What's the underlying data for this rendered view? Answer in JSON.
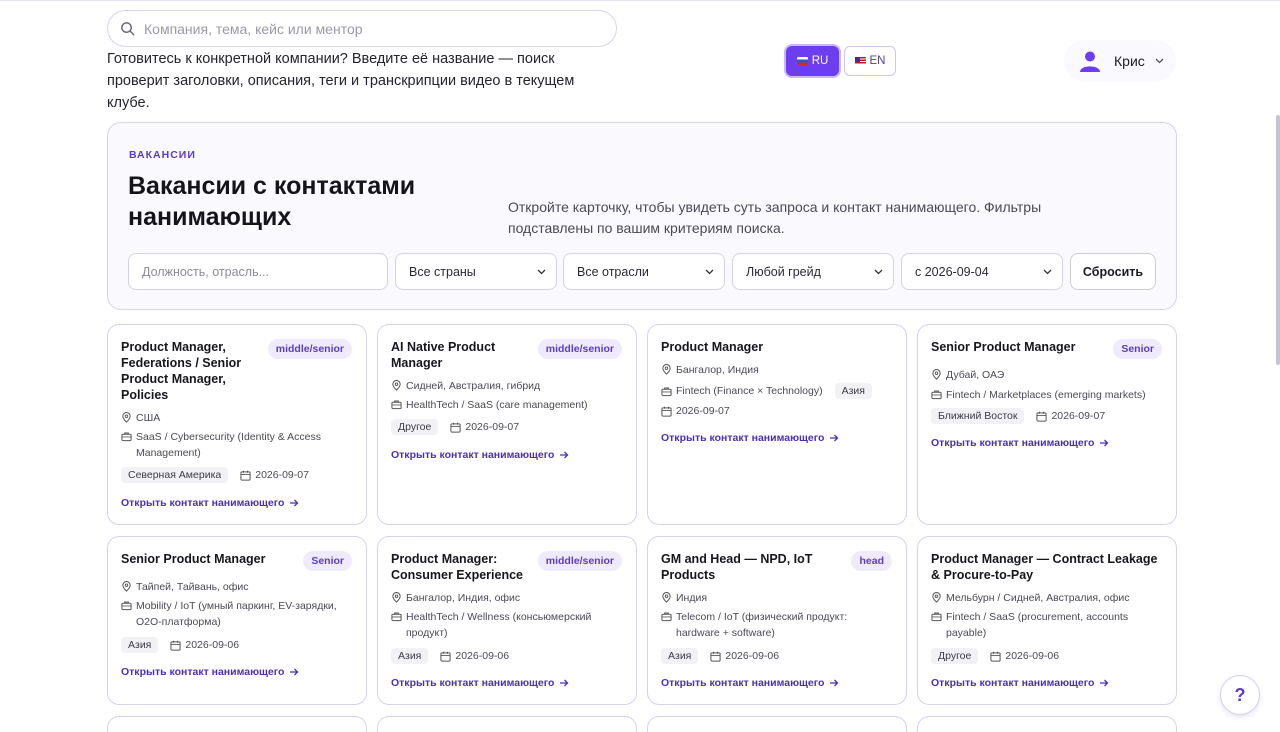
{
  "header": {
    "search_placeholder": "Компания, тема, кейс или ментор",
    "hint": "Готовитесь к конкретной компании? Введите её название — поиск проверит заголовки, описания, теги и транскрипции видео в текущем клубе.",
    "lang_ru": "RU",
    "lang_en": "EN",
    "user_name": "Крис"
  },
  "panel": {
    "eyebrow": "ВАКАНСИИ",
    "title": "Вакансии с контактами нанимающих",
    "description": "Откройте карточку, чтобы увидеть суть запроса и контакт нанимающего. Фильтры подставлены по вашим критериям поиска.",
    "filters": {
      "role_placeholder": "Должность, отрасль...",
      "country": "Все страны",
      "industry": "Все отрасли",
      "grade": "Любой грейд",
      "date": "с 2026-09-04",
      "reset": "Сбросить"
    }
  },
  "cta_label": "Открыть контакт нанимающего",
  "help_label": "?",
  "cards": [
    {
      "title": "Product Manager, Federations / Senior Product Manager, Policies",
      "badge": "middle/senior",
      "location": "США",
      "industry": "SaaS / Cybersecurity (Identity & Access Management)",
      "region": "Северная Америка",
      "date": "2026-09-07"
    },
    {
      "title": "AI Native Product Manager",
      "badge": "middle/senior",
      "location": "Сидней, Австралия, гибрид",
      "industry": "HealthTech / SaaS (care management)",
      "region": "Другое",
      "date": "2026-09-07"
    },
    {
      "title": "Product Manager",
      "badge": "",
      "location": "Бангалор, Индия",
      "industry": "Fintech (Finance × Technology)",
      "region": "Азия",
      "date": "2026-09-07"
    },
    {
      "title": "Senior Product Manager",
      "badge": "Senior",
      "location": "Дубай, ОАЭ",
      "industry": "Fintech / Marketplaces (emerging markets)",
      "region": "Ближний Восток",
      "date": "2026-09-07"
    },
    {
      "title": "Senior Product Manager",
      "badge": "Senior",
      "location": "Тайпей, Тайвань, офис",
      "industry": "Mobility / IoT (умный паркинг, EV-зарядки, O2O-платформа)",
      "region": "Азия",
      "date": "2026-09-06"
    },
    {
      "title": "Product Manager: Consumer Experience",
      "badge": "middle/senior",
      "location": "Бангалор, Индия, офис",
      "industry": "HealthTech / Wellness (консьюмерский продукт)",
      "region": "Азия",
      "date": "2026-09-06"
    },
    {
      "title": "GM and Head — NPD, IoT Products",
      "badge": "head",
      "location": "Индия",
      "industry": "Telecom / IoT (физический продукт: hardware + software)",
      "region": "Азия",
      "date": "2026-09-06"
    },
    {
      "title": "Product Manager — Contract Leakage & Procure-to-Pay",
      "badge": "",
      "location": "Мельбурн / Сидней, Австралия, офис",
      "industry": "Fintech / SaaS (procurement, accounts payable)",
      "region": "Другое",
      "date": "2026-09-06"
    }
  ],
  "colors": {
    "accent": "#6d3ef0",
    "accent_text": "#4b2fb5",
    "badge_bg": "#efebfd",
    "border": "#d7d2e8"
  }
}
